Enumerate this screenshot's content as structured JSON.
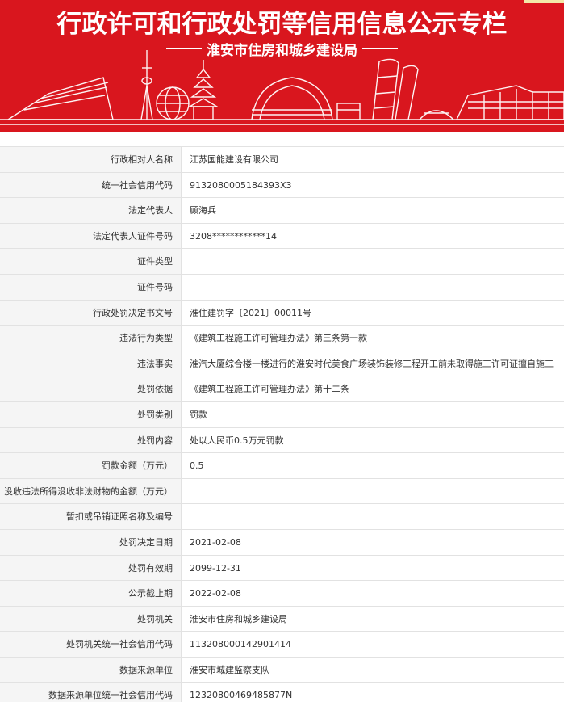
{
  "banner": {
    "title": "行政许可和行政处罚等信用信息公示专栏",
    "subtitle": "淮安市住房和城乡建设局"
  },
  "colors": {
    "banner_red": "#d9161e",
    "label_bg": "#f5f5f5",
    "border": "#e2e2e2",
    "text": "#333333"
  },
  "rows": [
    {
      "label": "行政相对人名称",
      "value": "江苏国能建设有限公司"
    },
    {
      "label": "统一社会信用代码",
      "value": "9132080005184393X3"
    },
    {
      "label": "法定代表人",
      "value": "顾海兵"
    },
    {
      "label": "法定代表人证件号码",
      "value": "3208************14"
    },
    {
      "label": "证件类型",
      "value": ""
    },
    {
      "label": "证件号码",
      "value": ""
    },
    {
      "label": "行政处罚决定书文号",
      "value": "淮住建罚字〔2021〕00011号"
    },
    {
      "label": "违法行为类型",
      "value": "《建筑工程施工许可管理办法》第三条第一款"
    },
    {
      "label": "违法事实",
      "value": "淮汽大厦综合楼一楼进行的淮安时代美食广场装饰装修工程开工前未取得施工许可证擅自施工"
    },
    {
      "label": "处罚依据",
      "value": "《建筑工程施工许可管理办法》第十二条"
    },
    {
      "label": "处罚类别",
      "value": "罚款"
    },
    {
      "label": "处罚内容",
      "value": "处以人民币0.5万元罚款"
    },
    {
      "label": "罚款金额（万元）",
      "value": "0.5"
    },
    {
      "label": "没收违法所得没收非法财物的金额（万元）",
      "value": ""
    },
    {
      "label": "暂扣或吊销证照名称及编号",
      "value": ""
    },
    {
      "label": "处罚决定日期",
      "value": "2021-02-08"
    },
    {
      "label": "处罚有效期",
      "value": "2099-12-31"
    },
    {
      "label": "公示截止期",
      "value": "2022-02-08"
    },
    {
      "label": "处罚机关",
      "value": "淮安市住房和城乡建设局"
    },
    {
      "label": "处罚机关统一社会信用代码",
      "value": "113208000142901414"
    },
    {
      "label": "数据来源单位",
      "value": "淮安市城建监察支队"
    },
    {
      "label": "数据来源单位统一社会信用代码",
      "value": "12320800469485877N"
    }
  ]
}
